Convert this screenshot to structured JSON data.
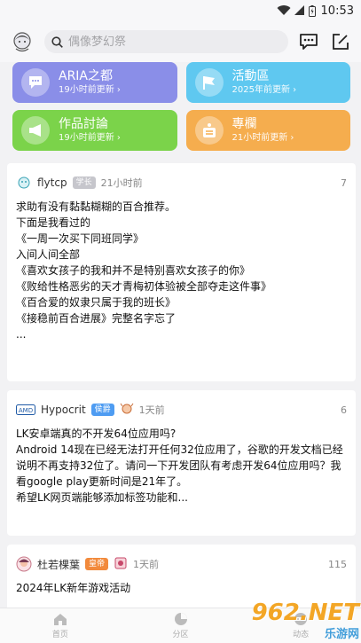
{
  "status": {
    "time": "10:53"
  },
  "search": {
    "placeholder": "偶像梦幻祭"
  },
  "tiles": [
    {
      "title": "ARIA之都",
      "subtitle": "19小时前更新 ›",
      "color": "#8a8ee8",
      "icon": "chat-bubble-icon"
    },
    {
      "title": "活動區",
      "subtitle": "2025年前更新 ›",
      "color": "#5fc8f0",
      "icon": "flag-icon"
    },
    {
      "title": "作品討論",
      "subtitle": "19小时前更新 ›",
      "color": "#7bd34a",
      "icon": "megaphone-icon"
    },
    {
      "title": "專欄",
      "subtitle": "21小时前更新 ›",
      "color": "#f5ad4e",
      "icon": "column-icon"
    }
  ],
  "posts": [
    {
      "user": "flytcp",
      "badge": "学长",
      "badge_color": "#c6c6cc",
      "time": "21小时前",
      "count": "7",
      "title": "求助有没有黏黏糊糊的百合推荐。",
      "body": "下面是我看过的\n《一周一次买下同班同学》\n入间人间全部\n《喜欢女孩子的我和并不是特别喜欢女孩子的你》\n《败给性格恶劣的天才青梅初体验被全部夺走这件事》\n《百合爱的奴隶只属于我的班长》\n《接稳前百合进展》完整名字忘了\n..."
    },
    {
      "user": "Hypocrit",
      "badge": "侯爵",
      "badge_color": "#4e9cf2",
      "time": "1天前",
      "count": "6",
      "title": "LK安卓端真的不开发64位应用吗?",
      "body": "Android 14现在已经无法打开任何32位应用了，谷歌的开发文档已经说明不再支持32位了。请问一下开发团队有考虑开发64位应用吗？我看google play更新时间是21年了。\n希望LK网页端能够添加标签功能和..."
    },
    {
      "user": "杜若棵葉",
      "badge": "皇帝",
      "badge_color": "#f28a3c",
      "time": "1天前",
      "count": "115",
      "title": "2024年LK新年游戏活动",
      "body": ""
    }
  ],
  "nav": [
    {
      "label": "首页",
      "icon": "home-icon"
    },
    {
      "label": "分区",
      "icon": "pie-chart-icon"
    },
    {
      "label": "动态",
      "icon": "face-icon"
    }
  ],
  "watermark": {
    "main": "962.NET",
    "sub": "乐游网"
  }
}
